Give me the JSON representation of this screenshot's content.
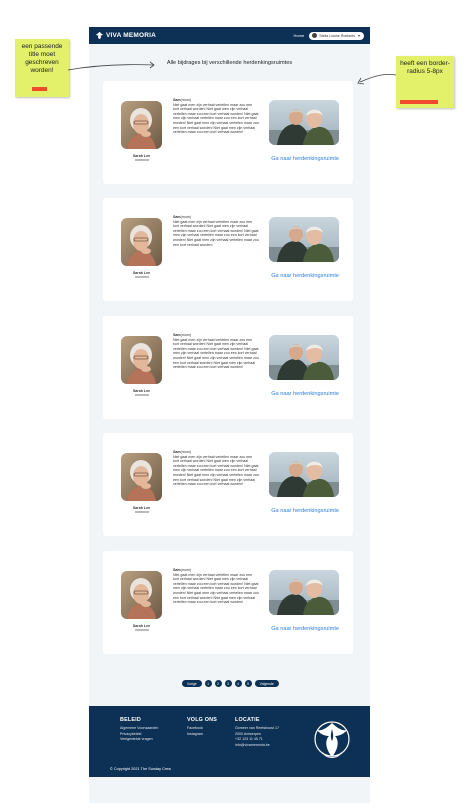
{
  "header": {
    "logo_text": "VIVA MEMORIA",
    "nav_home": "Home",
    "user_label": "Stella Louise Roelants"
  },
  "page_title": "Alle bijdrages bij verschillende herdenkingsruimtes",
  "cards": [
    {
      "person_name": "Sarah Lee",
      "author_name": "Sam",
      "author_relation": "(mum)",
      "text": "Niet gaat men zijn verhaal vertellen maar zou een kort verhaal worden! Niet gaat men zijn verhaal vertellen maar zou een kort verhaal worden! Niet gaat men zijn verhaal vertellen maar zou een kort verhaal worden! Niet gaat men zijn verhaal vertellen maar zou een kort verhaal worden! Niet gaat men zijn verhaal vertellen maar zou een kort verhaal worden!",
      "link": "Ga naar herdenkingsruimte"
    },
    {
      "person_name": "Sarah Lee",
      "author_name": "Sam",
      "author_relation": "(mum)",
      "text": "Niet gaat men zijn verhaal vertellen maar zou een kort verhaal worden! Niet gaat men zijn verhaal vertellen maar zou een kort verhaal worden! Niet gaat men zijn verhaal vertellen maar zou een kort verhaal worden! Niet gaat men zijn verhaal vertellen maar zou een kort verhaal worden!",
      "link": "Ga naar herdenkingsruimte"
    },
    {
      "person_name": "Sarah Lee",
      "author_name": "Sam",
      "author_relation": "(mum)",
      "text": "Niet gaat men zijn verhaal vertellen maar zou een kort verhaal worden! Niet gaat men zijn verhaal vertellen maar zou een kort verhaal worden! Niet gaat men zijn verhaal vertellen maar zou een kort verhaal worden! Niet gaat men zijn verhaal vertellen maar zou een kort verhaal worden! Niet gaat men zijn verhaal vertellen maar zou een kort verhaal worden!",
      "link": "Ga naar herdenkingsruimte"
    },
    {
      "person_name": "Sarah Lee",
      "author_name": "Sam",
      "author_relation": "(mum)",
      "text": "Niet gaat men zijn verhaal vertellen maar zou een kort verhaal worden! Niet gaat men zijn verhaal vertellen maar zou een kort verhaal worden! Niet gaat men zijn verhaal vertellen maar zou een kort verhaal worden! Niet gaat men zijn verhaal vertellen maar zou een kort verhaal worden! Niet gaat men zijn verhaal vertellen maar zou een kort verhaal worden!",
      "link": "Ga naar herdenkingsruimte"
    },
    {
      "person_name": "Sarah Lee",
      "author_name": "Sam",
      "author_relation": "(mum)",
      "text": "Niet gaat men zijn verhaal vertellen maar zou een kort verhaal worden! Niet gaat men zijn verhaal vertellen maar zou een kort verhaal worden! Niet gaat men zijn verhaal vertellen maar zou een kort verhaal worden! Niet gaat men zijn verhaal vertellen maar zou een kort verhaal worden! Niet gaat men zijn verhaal vertellen maar zou een kort verhaal worden!",
      "link": "Ga naar herdenkingsruimte"
    }
  ],
  "pagination": {
    "prev": "Vorige",
    "pages": [
      "1",
      "2",
      "3",
      "4",
      "5"
    ],
    "next": "Volgende"
  },
  "footer": {
    "beleid": {
      "heading": "BELEID",
      "items": [
        "Algemene Voorwaarden",
        "Privacybeleid",
        "Veelgestelde vragen"
      ]
    },
    "volg": {
      "heading": "VOLG ONS",
      "items": [
        "Facebook",
        "Instagram"
      ]
    },
    "locatie": {
      "heading": "LOCATIE",
      "items": [
        "Gomeer van Reetshoost 17",
        "2000 Antwerpen",
        "+32 123 11 45 71",
        "info@vivamemoria.be"
      ]
    },
    "copyright": "© Copyright 2021 The Sunday Crew"
  },
  "annotations": {
    "left_note": "een passende title moet geschreven worden!",
    "right_note": "heeft een border-radius 5-8px"
  },
  "colors": {
    "navy": "#0c3155",
    "link_blue": "#2f7ed8",
    "sticky_yellow": "#e2f06a",
    "sticky_bar": "#ee4a2b"
  }
}
